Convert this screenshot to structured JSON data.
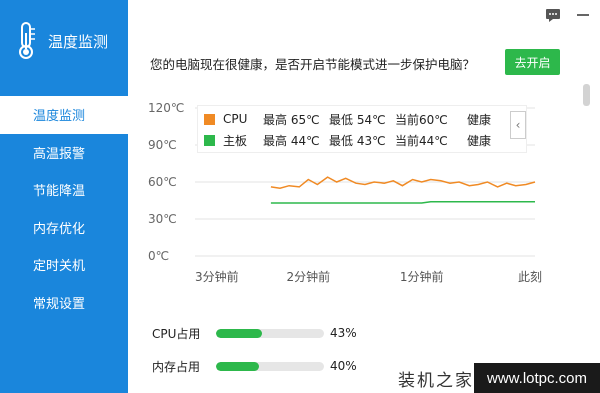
{
  "app": {
    "title": "温度监测"
  },
  "nav": {
    "items": [
      {
        "label": "温度监测"
      },
      {
        "label": "高温报警"
      },
      {
        "label": "节能降温"
      },
      {
        "label": "内存优化"
      },
      {
        "label": "定时关机"
      },
      {
        "label": "常规设置"
      }
    ]
  },
  "topbar": {
    "icons": [
      "chat-icon",
      "minimize-icon"
    ]
  },
  "prompt": {
    "text": "您的电脑现在很健康，是否开启节能模式进一步保护电脑？",
    "button": "去开启"
  },
  "legend": {
    "rows": [
      {
        "name": "CPU",
        "max": "最高 65℃",
        "min": "最低 54℃",
        "current": "当前60℃",
        "status": "健康",
        "color": "#f08a24"
      },
      {
        "name": "主板",
        "max": "最高 44℃",
        "min": "最低 43℃",
        "current": "当前44℃",
        "status": "健康",
        "color": "#2db84b"
      }
    ],
    "collapse": "‹"
  },
  "chart_data": {
    "type": "line",
    "y_ticks": [
      "120℃",
      "90℃",
      "60℃",
      "30℃",
      "0℃"
    ],
    "x_ticks": [
      "3分钟前",
      "2分钟前",
      "1分钟前",
      "此刻"
    ],
    "ylim": [
      0,
      120
    ],
    "x": [
      -2.33,
      -2.25,
      -2.17,
      -2.08,
      -2.0,
      -1.92,
      -1.83,
      -1.75,
      -1.67,
      -1.58,
      -1.5,
      -1.42,
      -1.33,
      -1.25,
      -1.17,
      -1.08,
      -1.0,
      -0.92,
      -0.83,
      -0.75,
      -0.67,
      -0.58,
      -0.5,
      -0.42,
      -0.33,
      -0.25,
      -0.17,
      -0.08,
      0.0
    ],
    "x_unit": "分钟",
    "series": [
      {
        "name": "CPU",
        "color": "#f08a24",
        "values": [
          56,
          55,
          57,
          56,
          62,
          58,
          64,
          60,
          63,
          59,
          58,
          60,
          59,
          61,
          57,
          62,
          60,
          62,
          61,
          59,
          60,
          57,
          58,
          60,
          56,
          59,
          57,
          58,
          60
        ]
      },
      {
        "name": "主板",
        "color": "#2db84b",
        "values": [
          43,
          43,
          43,
          43,
          43,
          43,
          43,
          43,
          43,
          43,
          43,
          43,
          43,
          43,
          43,
          43,
          43,
          44,
          44,
          44,
          44,
          44,
          44,
          44,
          44,
          44,
          44,
          44,
          44
        ]
      }
    ],
    "grid": true,
    "grid_color": "#e3e3e3"
  },
  "usage": [
    {
      "label": "CPU占用",
      "value": "43%",
      "fraction": 0.43
    },
    {
      "label": "内存占用",
      "value": "40%",
      "fraction": 0.4
    }
  ],
  "watermark": {
    "cn": "装机之家",
    "url": "www.lotpc.com"
  },
  "colors": {
    "sidebar": "#1a86dc",
    "accent_green": "#2db84b",
    "cpu_orange": "#f08a24"
  }
}
